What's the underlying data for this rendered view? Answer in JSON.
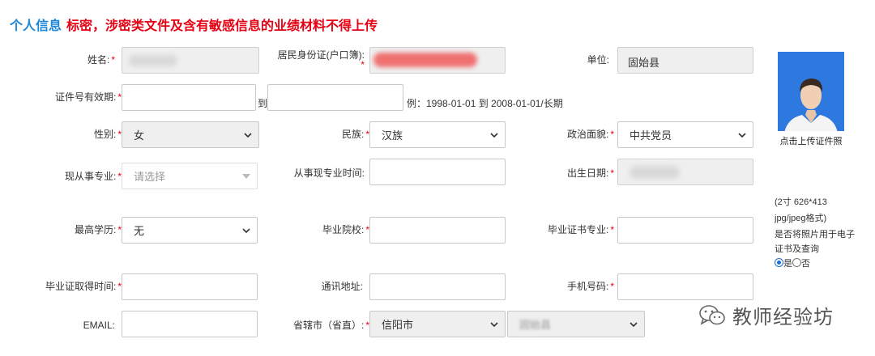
{
  "header": {
    "title": "个人信息",
    "warning": "标密，涉密类文件及含有敏感信息的业绩材料不得上传"
  },
  "fields": {
    "name": {
      "label": "姓名:",
      "value": ""
    },
    "id_card": {
      "label": "居民身份证(户口簿):",
      "value": ""
    },
    "unit": {
      "label": "单位:",
      "value": "固始县"
    },
    "cert_validity": {
      "label": "证件号有效期:",
      "to": "到",
      "hint": "例：1998-01-01 到 2008-01-01/长期",
      "start": "",
      "end": ""
    },
    "gender": {
      "label": "性别:",
      "value": "女"
    },
    "ethnicity": {
      "label": "民族:",
      "value": "汉族"
    },
    "political": {
      "label": "政治面貌:",
      "value": "中共党员"
    },
    "major": {
      "label": "现从事专业:",
      "value": "请选择"
    },
    "major_time": {
      "label": "从事现专业时间:",
      "value": ""
    },
    "birth_date": {
      "label": "出生日期:",
      "value": ""
    },
    "education": {
      "label": "最高学历:",
      "value": "无"
    },
    "school": {
      "label": "毕业院校:",
      "value": ""
    },
    "grad_major": {
      "label": "毕业证书专业:",
      "value": ""
    },
    "grad_time": {
      "label": "毕业证取得时间:",
      "value": ""
    },
    "address": {
      "label": "通讯地址:",
      "value": ""
    },
    "phone": {
      "label": "手机号码:",
      "value": ""
    },
    "email": {
      "label": "EMAIL:",
      "value": ""
    },
    "province": {
      "label": "省辖市（省直）:",
      "value": "信阳市",
      "county": "固始县"
    }
  },
  "required_mark": "*",
  "photo": {
    "upload_label": "点击上传证件照",
    "size_note_1": "(2寸 626*413",
    "size_note_2": "jpg/jpeg格式)",
    "use_note_1": "是否将照片用于电子",
    "use_note_2": "证书及查询",
    "yes": "是",
    "no": "否",
    "selected": "yes"
  },
  "watermark": {
    "text": "教师经验坊",
    "icon": "wechat-icon"
  },
  "colors": {
    "accent": "#1e87d8",
    "warning": "#e60012"
  }
}
